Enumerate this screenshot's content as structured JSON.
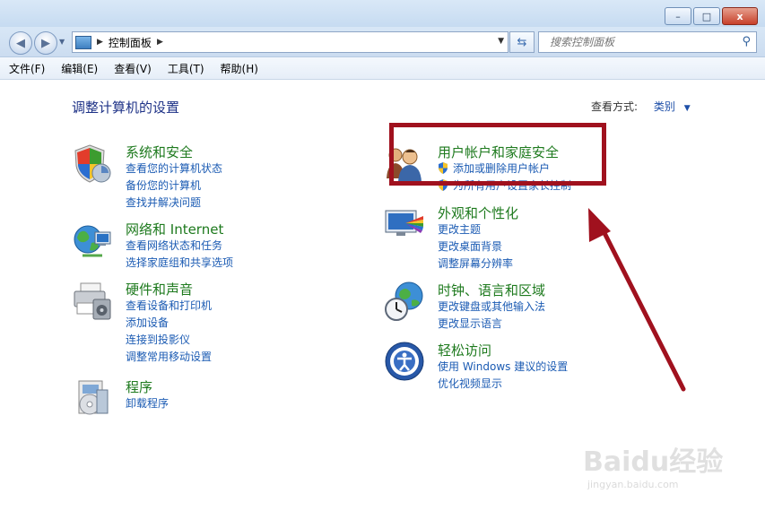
{
  "window": {
    "minimize_label": "–",
    "maximize_label": "□",
    "close_label": "x"
  },
  "address": {
    "breadcrumb": "控制面板",
    "search_placeholder": "搜索控制面板"
  },
  "menu": [
    "文件(F)",
    "编辑(E)",
    "查看(V)",
    "工具(T)",
    "帮助(H)"
  ],
  "main": {
    "heading": "调整计算机的设置",
    "view_by_label": "查看方式:",
    "view_by_value": "类别"
  },
  "categories_left": [
    {
      "title": "系统和安全",
      "links": [
        "查看您的计算机状态",
        "备份您的计算机",
        "查找并解决问题"
      ]
    },
    {
      "title": "网络和 Internet",
      "links": [
        "查看网络状态和任务",
        "选择家庭组和共享选项"
      ]
    },
    {
      "title": "硬件和声音",
      "links": [
        "查看设备和打印机",
        "添加设备",
        "连接到投影仪",
        "调整常用移动设置"
      ]
    },
    {
      "title": "程序",
      "links": [
        "卸载程序"
      ]
    }
  ],
  "categories_right": [
    {
      "title": "用户帐户和家庭安全",
      "links": [
        "添加或删除用户帐户",
        "为所有用户设置家长控制"
      ]
    },
    {
      "title": "外观和个性化",
      "links": [
        "更改主题",
        "更改桌面背景",
        "调整屏幕分辨率"
      ]
    },
    {
      "title": "时钟、语言和区域",
      "links": [
        "更改键盘或其他输入法",
        "更改显示语言"
      ]
    },
    {
      "title": "轻松访问",
      "links": [
        "使用 Windows 建议的设置",
        "优化视频显示"
      ]
    }
  ],
  "watermark": {
    "brand": "Baidu经验",
    "url": "jingyan.baidu.com"
  },
  "colors": {
    "category_title": "#1e7a1e",
    "link": "#1b5bb3",
    "heading": "#1e3287",
    "highlight": "#a0111e",
    "arrow": "#a0111e"
  }
}
